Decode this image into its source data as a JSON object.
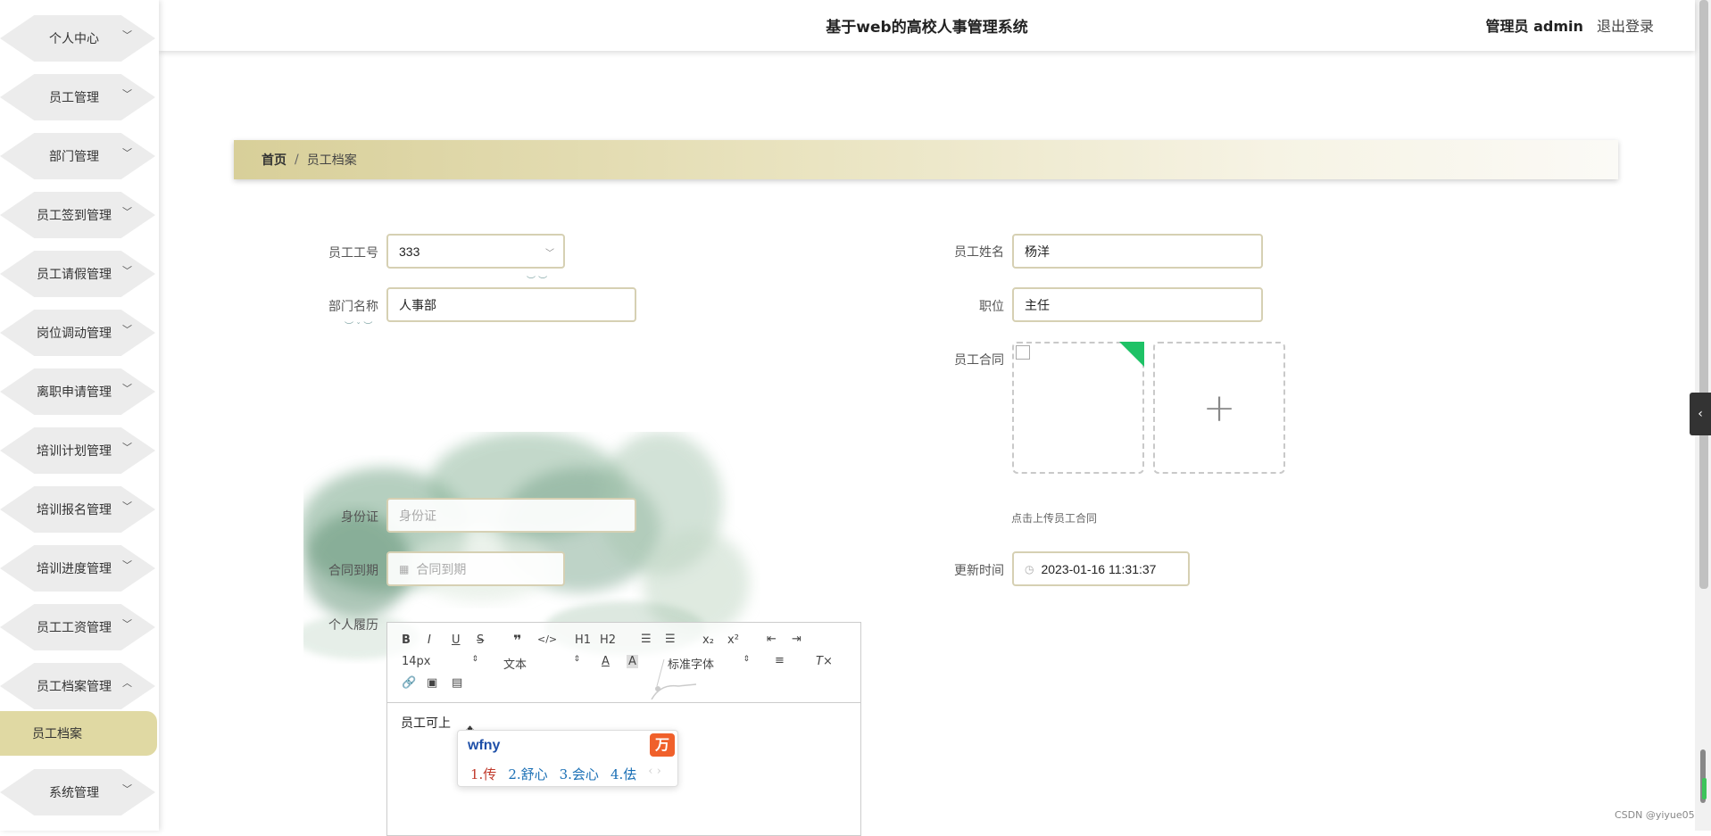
{
  "sidebar": {
    "items": [
      {
        "label": "个人中心",
        "expanded": false
      },
      {
        "label": "员工管理",
        "expanded": false
      },
      {
        "label": "部门管理",
        "expanded": false
      },
      {
        "label": "员工签到管理",
        "expanded": false
      },
      {
        "label": "员工请假管理",
        "expanded": false
      },
      {
        "label": "岗位调动管理",
        "expanded": false
      },
      {
        "label": "离职申请管理",
        "expanded": false
      },
      {
        "label": "培训计划管理",
        "expanded": false
      },
      {
        "label": "培训报名管理",
        "expanded": false
      },
      {
        "label": "培训进度管理",
        "expanded": false
      },
      {
        "label": "员工工资管理",
        "expanded": false
      },
      {
        "label": "员工档案管理",
        "expanded": true
      },
      {
        "label": "系统管理",
        "expanded": false
      }
    ],
    "active_subitem": "员工档案",
    "accent": "#e0d9a3"
  },
  "header": {
    "title": "基于web的高校人事管理系统",
    "role": "管理员 admin",
    "logout": "退出登录"
  },
  "breadcrumb": {
    "home": "首页",
    "separator": "/",
    "current": "员工档案"
  },
  "form": {
    "employee_no": {
      "label": "员工工号",
      "value": "333"
    },
    "employee_name": {
      "label": "员工姓名",
      "value": "杨洋"
    },
    "department": {
      "label": "部门名称",
      "value": "人事部"
    },
    "position": {
      "label": "职位",
      "value": "主任"
    },
    "contract": {
      "label": "员工合同",
      "tip": "点击上传员工合同"
    },
    "id_card": {
      "label": "身份证",
      "placeholder": "身份证"
    },
    "contract_expiry": {
      "label": "合同到期",
      "placeholder": "合同到期"
    },
    "updated_time": {
      "label": "更新时间",
      "value": "2023-01-16 11:31:37"
    },
    "resume": {
      "label": "个人履历",
      "content": "员工可上"
    }
  },
  "editor_toolbar": {
    "font_size": "14px",
    "header_select": "文本",
    "font_family": "标准字体",
    "h1": "H1",
    "h2": "H2"
  },
  "ime": {
    "input": "wfny",
    "candidates": [
      "1.传",
      "2.舒心",
      "3.会心",
      "4.佉"
    ],
    "nav": "‹ ›"
  },
  "watermark": "CSDN @yiyue05"
}
